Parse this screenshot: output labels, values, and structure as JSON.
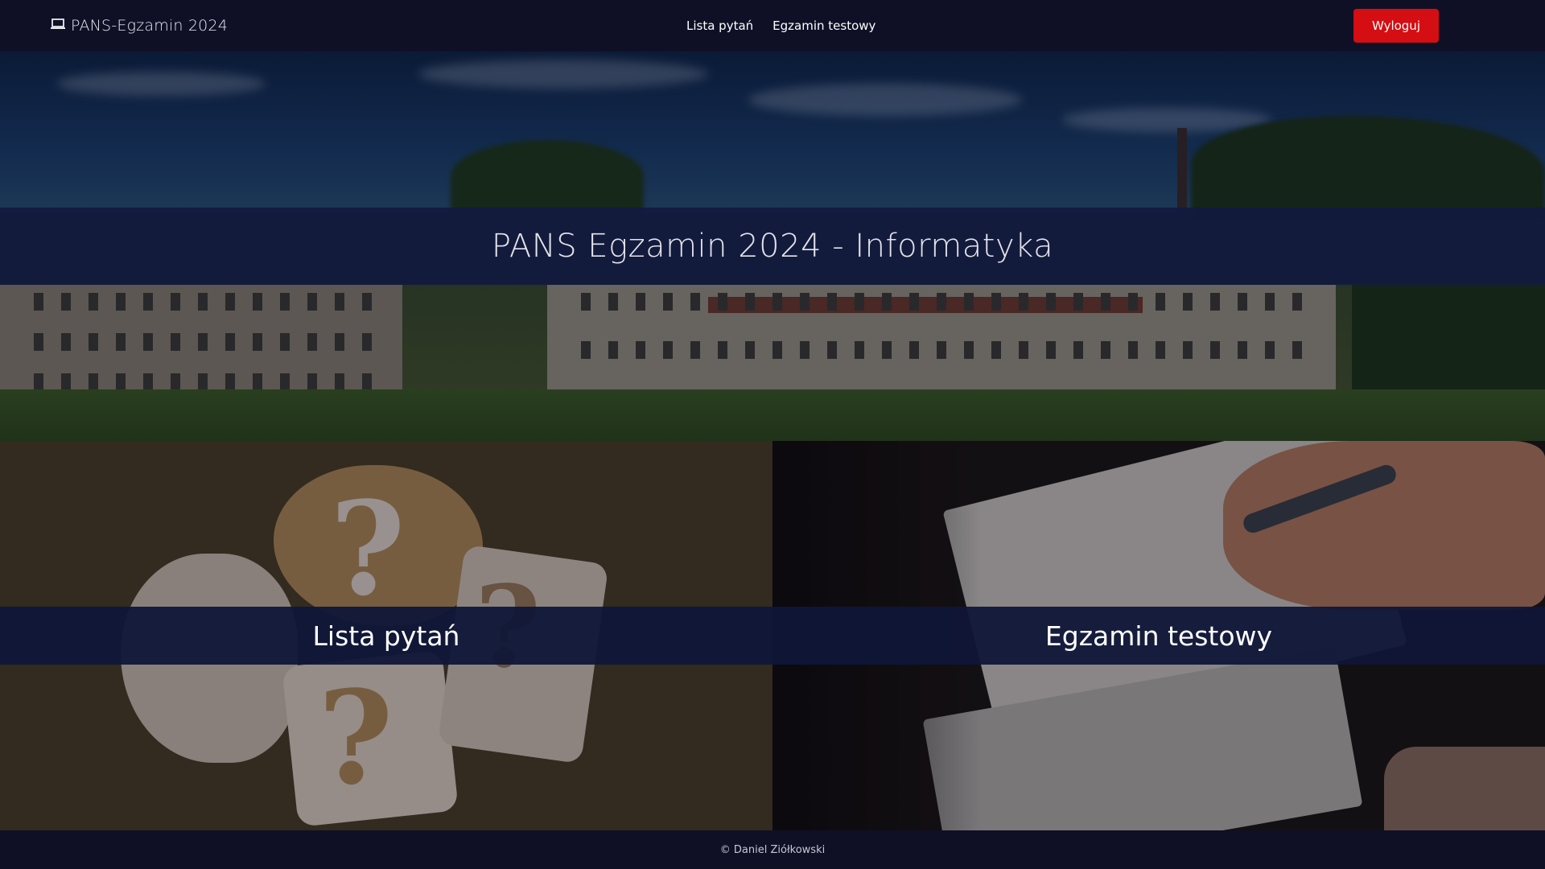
{
  "navbar": {
    "brand_icon": "laptop-icon",
    "brand": "PANS-Egzamin 2024",
    "links": [
      "Lista pytań",
      "Egzamin testowy"
    ],
    "logout_label": "Wyloguj",
    "logout_color": "#d40e12"
  },
  "hero": {
    "title": "PANS Egzamin 2024 - Informatyka"
  },
  "tiles": [
    {
      "label": "Lista pytań"
    },
    {
      "label": "Egzamin testowy"
    }
  ],
  "footer": {
    "copyright": "© Daniel Ziółkowski"
  },
  "colors": {
    "navbar_bg": "#0f1026",
    "band_bg": "#121a40",
    "accent_red": "#d40e12"
  }
}
